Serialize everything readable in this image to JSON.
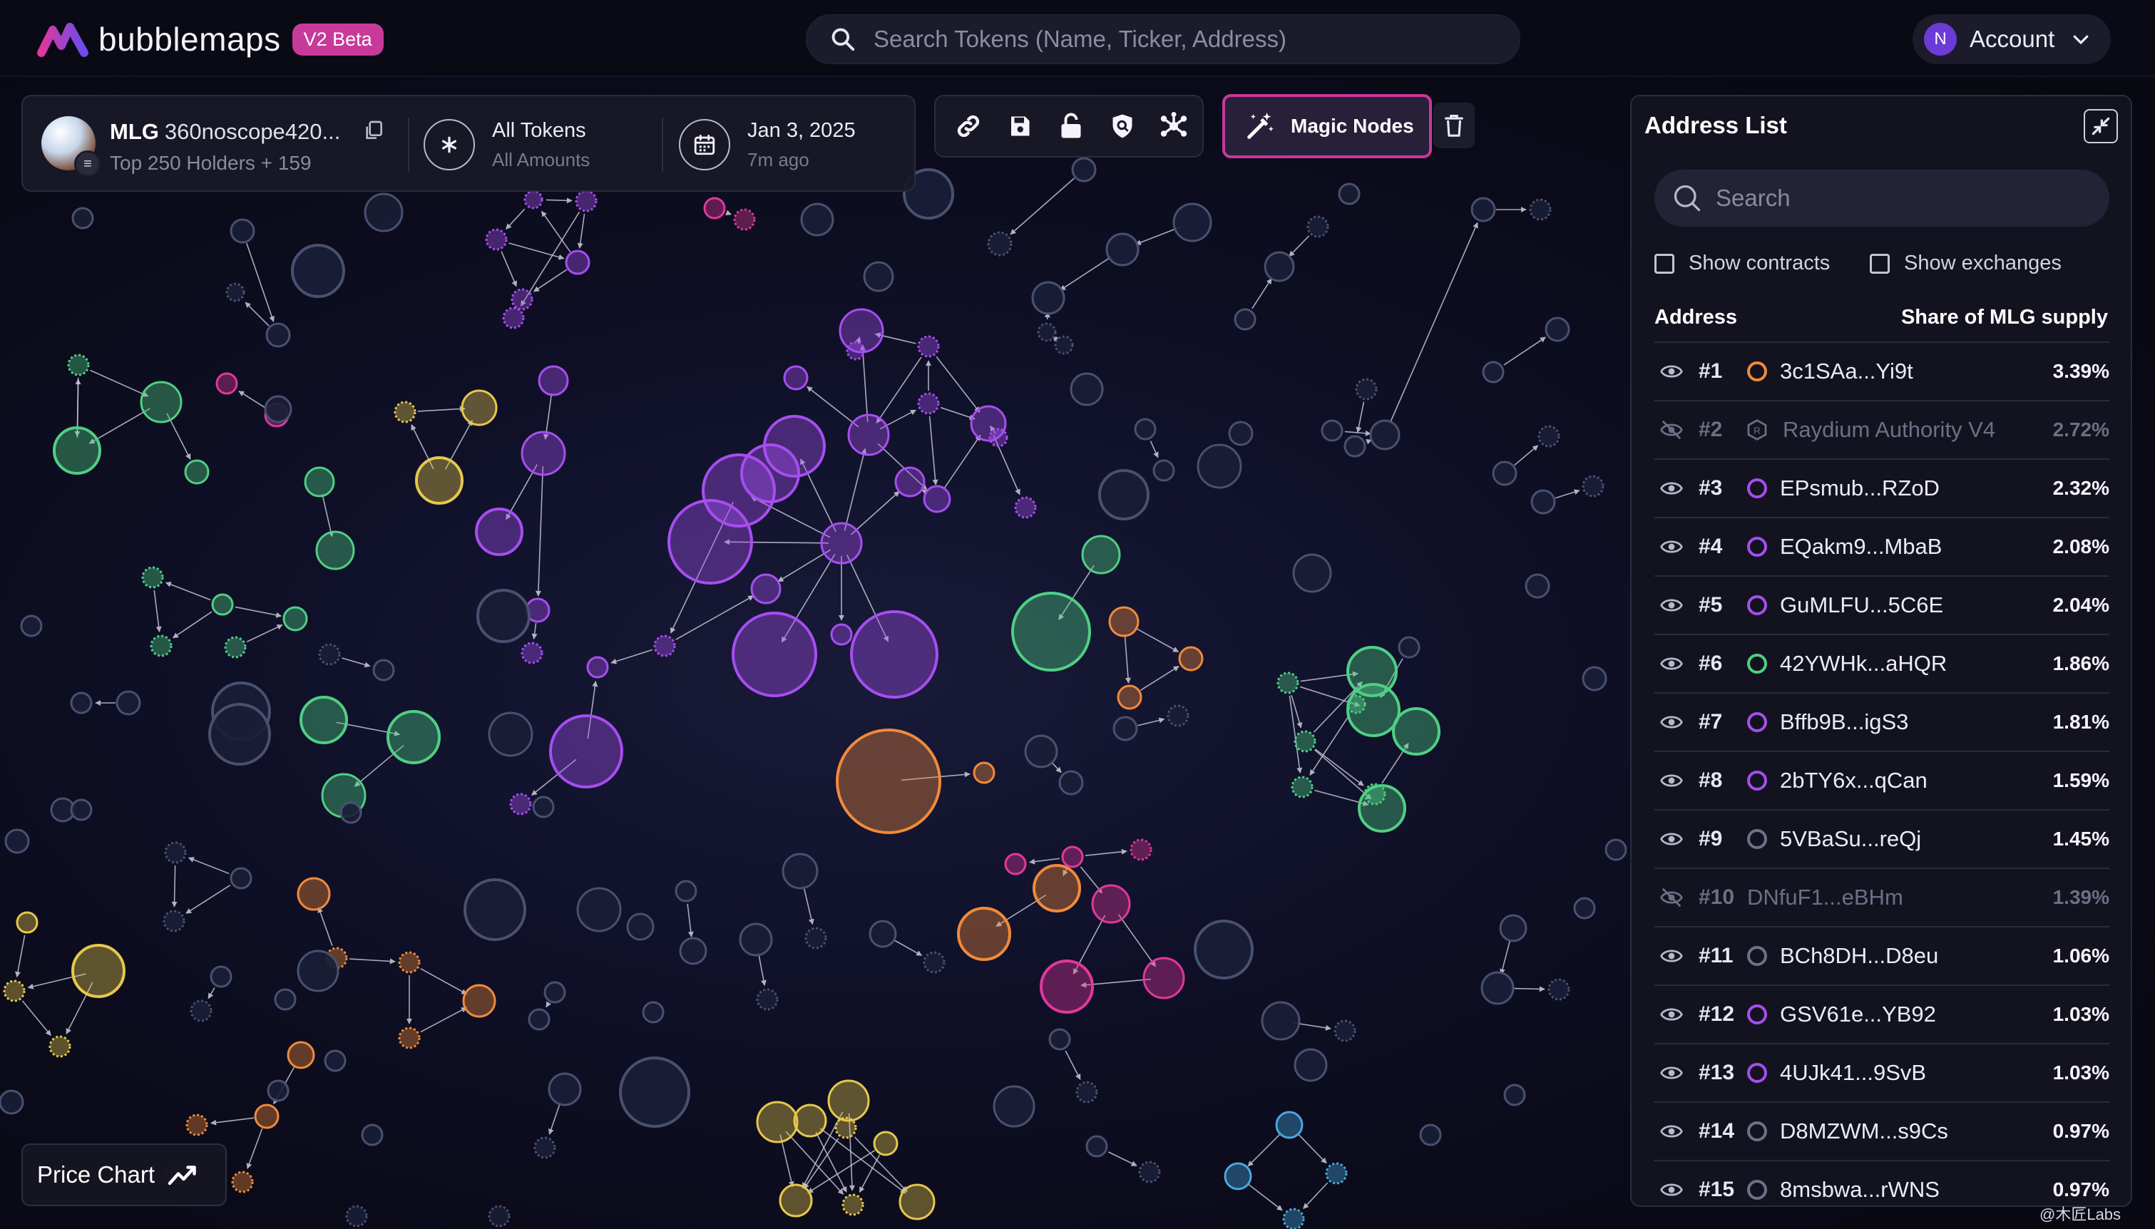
{
  "app": {
    "name": "bubblemaps",
    "badge": "V2 Beta"
  },
  "search": {
    "placeholder": "Search Tokens (Name, Ticker, Address)"
  },
  "account": {
    "initial": "N",
    "label": "Account"
  },
  "token": {
    "ticker": "MLG",
    "name": "360noscope420...",
    "holders": "Top 250 Holders + 159",
    "chain_icon": "solana-icon",
    "filter_title": "All Tokens",
    "filter_sub": "All Amounts",
    "date": "Jan 3, 2025",
    "date_ago": "7m ago"
  },
  "toolbar": {
    "icons": [
      "link-icon",
      "save-icon",
      "unlock-icon",
      "shield-search-icon",
      "network-icon"
    ],
    "magic_label": "Magic Nodes",
    "trash_icon": "trash-icon"
  },
  "address_list": {
    "title": "Address List",
    "search_placeholder": "Search",
    "show_contracts": "Show contracts",
    "show_exchanges": "Show exchanges",
    "col_address": "Address",
    "col_share": "Share of MLG supply",
    "rows": [
      {
        "rank": "#1",
        "address": "3c1SAa...Yi9t",
        "share": "3.39%",
        "color": "#f08a3a",
        "hidden": false
      },
      {
        "rank": "#2",
        "address": "Raydium Authority V4",
        "share": "2.72%",
        "color": "#7a7a90",
        "hidden": true,
        "contract": true
      },
      {
        "rank": "#3",
        "address": "EPsmub...RZoD",
        "share": "2.32%",
        "color": "#a64ef0",
        "hidden": false
      },
      {
        "rank": "#4",
        "address": "EQakm9...MbaB",
        "share": "2.08%",
        "color": "#a64ef0",
        "hidden": false
      },
      {
        "rank": "#5",
        "address": "GuMLFU...5C6E",
        "share": "2.04%",
        "color": "#a64ef0",
        "hidden": false
      },
      {
        "rank": "#6",
        "address": "42YWHk...aHQR",
        "share": "1.86%",
        "color": "#4fcf84",
        "hidden": false
      },
      {
        "rank": "#7",
        "address": "Bffb9B...igS3",
        "share": "1.81%",
        "color": "#a64ef0",
        "hidden": false
      },
      {
        "rank": "#8",
        "address": "2bTY6x...qCan",
        "share": "1.59%",
        "color": "#a64ef0",
        "hidden": false
      },
      {
        "rank": "#9",
        "address": "5VBaSu...reQj",
        "share": "1.45%",
        "color": "#6e7288",
        "hidden": false
      },
      {
        "rank": "#10",
        "address": "DNfuF1...eBHm",
        "share": "1.39%",
        "color": "#6e7288",
        "hidden": true,
        "nodot": true
      },
      {
        "rank": "#11",
        "address": "BCh8DH...D8eu",
        "share": "1.06%",
        "color": "#6e7288",
        "hidden": false
      },
      {
        "rank": "#12",
        "address": "GSV61e...YB92",
        "share": "1.03%",
        "color": "#a64ef0",
        "hidden": false
      },
      {
        "rank": "#13",
        "address": "4UJk41...9SvB",
        "share": "1.03%",
        "color": "#a64ef0",
        "hidden": false
      },
      {
        "rank": "#14",
        "address": "D8MZWM...s9Cs",
        "share": "0.97%",
        "color": "#6e7288",
        "hidden": false
      },
      {
        "rank": "#15",
        "address": "8msbwa...rWNS",
        "share": "0.97%",
        "color": "#6e7288",
        "hidden": false
      }
    ]
  },
  "price_chart": {
    "label": "Price Chart"
  },
  "watermark": "@木匠Labs",
  "colors": {
    "purple": "#a64ef0",
    "green": "#4fcf84",
    "orange": "#f08a3a",
    "pink": "#e0389a",
    "yellow": "#e6c84a",
    "gray": "#5a6080",
    "cyan": "#48a8e0",
    "accent": "#c7399b"
  }
}
